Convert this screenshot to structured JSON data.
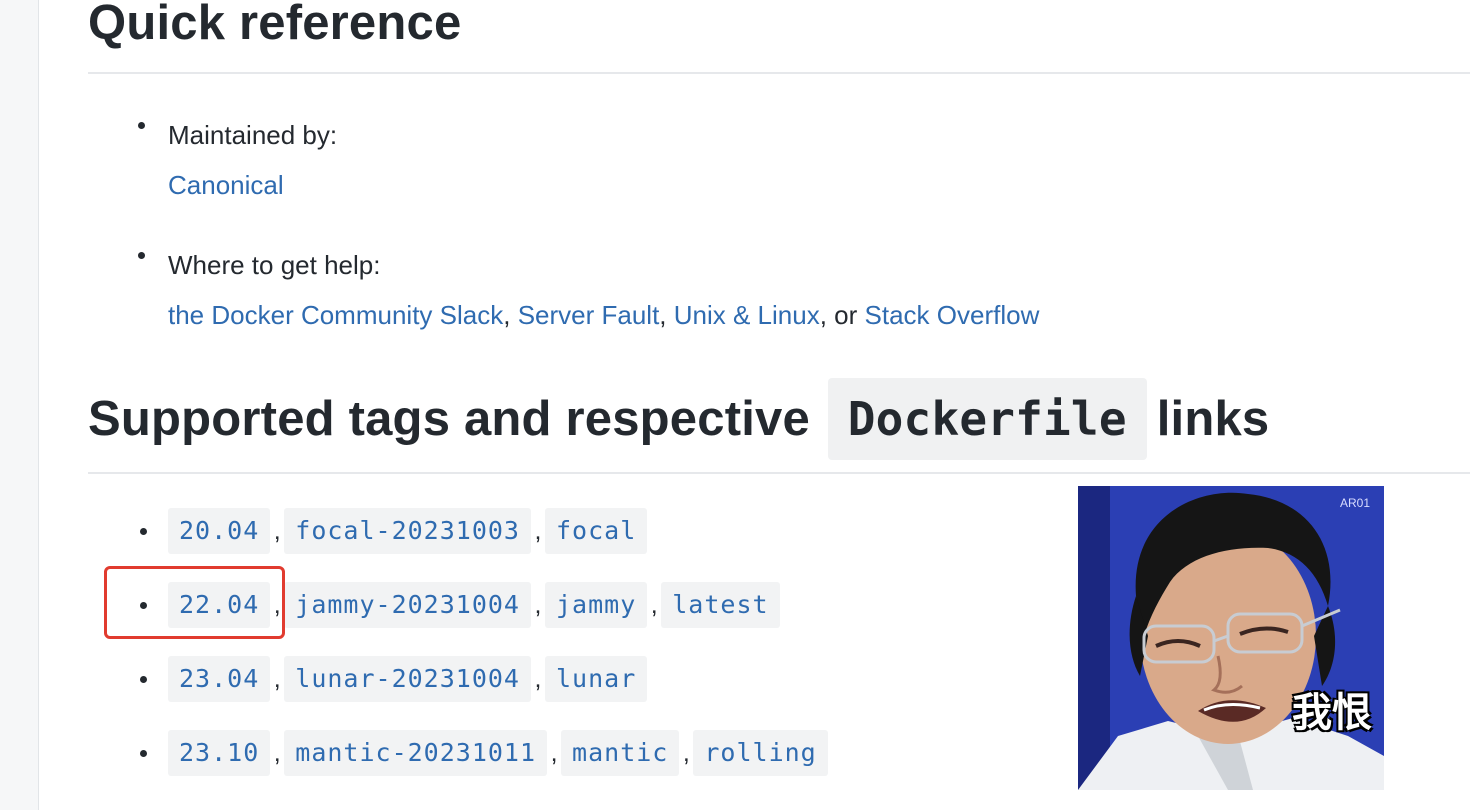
{
  "quick_reference": {
    "heading": "Quick reference",
    "maintained_by": {
      "label": "Maintained by:",
      "link": "Canonical"
    },
    "help": {
      "label": "Where to get help:",
      "links": [
        "the Docker Community Slack",
        "Server Fault",
        "Unix & Linux",
        "Stack Overflow"
      ],
      "separators": [
        ", ",
        ", ",
        ", or "
      ]
    }
  },
  "supported_tags": {
    "heading_prefix": "Supported tags and respective",
    "heading_code": "Dockerfile",
    "heading_suffix": "links",
    "rows": [
      [
        "20.04",
        "focal-20231003",
        "focal"
      ],
      [
        "22.04",
        "jammy-20231004",
        "jammy",
        "latest"
      ],
      [
        "23.04",
        "lunar-20231004",
        "lunar"
      ],
      [
        "23.10",
        "mantic-20231011",
        "mantic",
        "rolling"
      ]
    ]
  },
  "annotation": {
    "highlight_color": "#e13b2f",
    "highlighted_tag": "22.04"
  },
  "meme": {
    "caption": "我恨",
    "watermark": "AR01"
  },
  "colors": {
    "link": "#2f6bb0",
    "text": "#24292f",
    "code_bg": "#f2f3f4"
  }
}
